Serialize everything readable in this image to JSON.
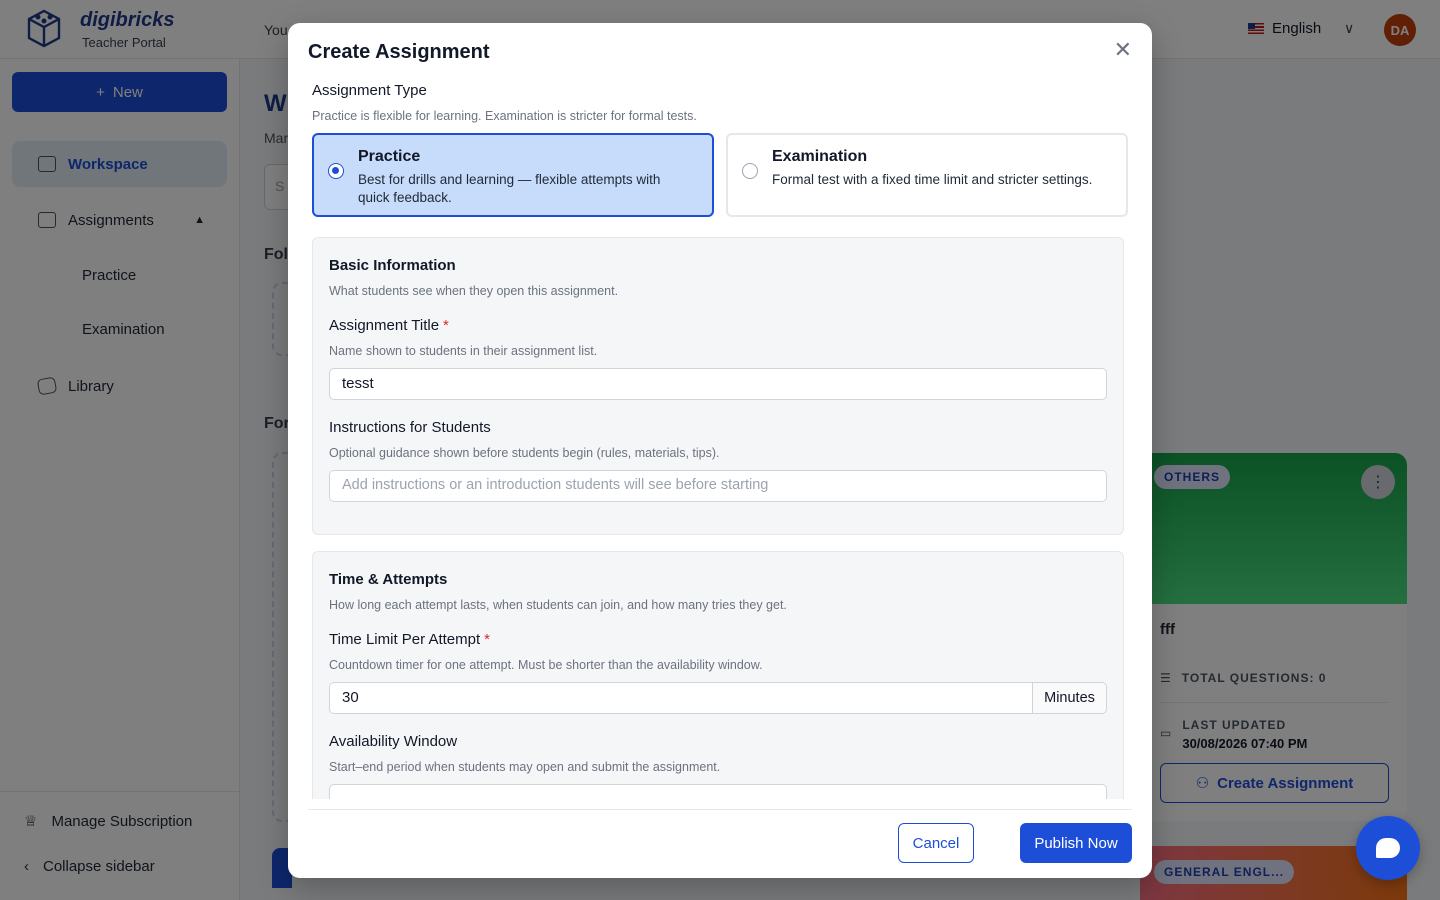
{
  "app": {
    "brand": "digibricks",
    "portal": "Teacher Portal",
    "top_hint": "You",
    "language": "English",
    "avatar_initials": "DA"
  },
  "sidebar": {
    "new_label": "New",
    "items": [
      {
        "label": "Workspace",
        "icon": "workspace-icon",
        "active": true
      },
      {
        "label": "Assignments",
        "icon": "assignments-icon"
      },
      {
        "label": "Practice"
      },
      {
        "label": "Examination"
      },
      {
        "label": "Library",
        "icon": "library-icon"
      }
    ],
    "footer": {
      "manage_subscription": "Manage Subscription",
      "collapse_sidebar": "Collapse sidebar"
    }
  },
  "main": {
    "title_fragment": "W",
    "subtitle_fragment": "Mar",
    "search_fragment": "S",
    "folders_fragment": "Fol",
    "forms_fragment": "For"
  },
  "background_card": {
    "badge": "OTHERS",
    "title": "fff",
    "total_questions": "TOTAL QUESTIONS: 0",
    "last_updated_label": "LAST UPDATED",
    "last_updated_value": "30/08/2026  07:40 PM",
    "button": "Create Assignment",
    "next_badge": "GENERAL ENGL..."
  },
  "modal": {
    "title": "Create Assignment",
    "assignment_type": {
      "label": "Assignment Type",
      "help": "Practice is flexible for learning. Examination is stricter for formal tests.",
      "options": [
        {
          "name": "Practice",
          "desc": "Best for drills and learning — flexible attempts with quick feedback.",
          "selected": true
        },
        {
          "name": "Examination",
          "desc": "Formal test with a fixed time limit and stricter settings.",
          "selected": false
        }
      ]
    },
    "basic_info": {
      "title": "Basic Information",
      "help": "What students see when they open this assignment.",
      "title_label": "Assignment Title",
      "title_help": "Name shown to students in their assignment list.",
      "title_value": "tesst",
      "instructions_label": "Instructions for Students",
      "instructions_help": "Optional guidance shown before students begin (rules, materials, tips).",
      "instructions_placeholder": "Add instructions or an introduction students will see before starting"
    },
    "time_attempts": {
      "title": "Time & Attempts",
      "help": "How long each attempt lasts, when students can join, and how many tries they get.",
      "time_limit_label": "Time Limit Per Attempt",
      "time_limit_help": "Countdown timer for one attempt. Must be shorter than the availability window.",
      "time_limit_value": "30",
      "time_limit_unit": "Minutes",
      "availability_label": "Availability Window",
      "availability_help": "Start–end period when students may open and submit the assignment."
    },
    "cancel_label": "Cancel",
    "publish_label": "Publish Now"
  }
}
